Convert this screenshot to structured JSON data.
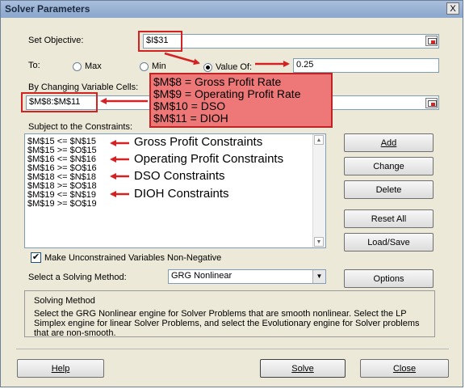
{
  "window": {
    "title": "Solver Parameters",
    "close_glyph": "X"
  },
  "objective": {
    "label": "Set Objective:",
    "value": "$I$31"
  },
  "to": {
    "label": "To:",
    "options": [
      {
        "label": "Max",
        "selected": false
      },
      {
        "label": "Min",
        "selected": false
      },
      {
        "label": "Value Of:",
        "selected": true
      }
    ],
    "value_of": "0.25"
  },
  "variables": {
    "label": "By Changing Variable Cells:",
    "value": "$M$8:$M$11"
  },
  "callout": {
    "lines": [
      "$M$8 = Gross Profit Rate",
      "$M$9 = Operating Profit Rate",
      "$M$10 = DSO",
      "$M$11 = DIOH"
    ]
  },
  "constraints": {
    "label": "Subject to the Constraints:",
    "items": [
      "$M$15 <= $N$15",
      "$M$15 >= $O$15",
      "$M$16 <= $N$16",
      "$M$16 >= $O$16",
      "$M$18 <= $N$18",
      "$M$18 >= $O$18",
      "$M$19 <= $N$19",
      "$M$19 >= $O$19"
    ],
    "annotations": [
      "Gross Profit Constraints",
      "Operating Profit Constraints",
      "DSO Constraints",
      "DIOH Constraints"
    ]
  },
  "buttons": {
    "add": "Add",
    "change": "Change",
    "delete": "Delete",
    "reset_all": "Reset All",
    "load_save": "Load/Save",
    "options": "Options",
    "help": "Help",
    "solve": "Solve",
    "close": "Close"
  },
  "unconstrained": {
    "label": "Make Unconstrained Variables Non-Negative",
    "checked": true,
    "check_glyph": "✔"
  },
  "method": {
    "label": "Select a Solving Method:",
    "value": "GRG Nonlinear"
  },
  "solving": {
    "title": "Solving Method",
    "text": "Select the GRG Nonlinear engine for Solver Problems that are smooth nonlinear. Select the LP Simplex engine for linear Solver Problems, and select the Evolutionary engine for Solver problems that are non-smooth."
  },
  "colors": {
    "annotation_red": "#d42222",
    "callout_fill": "#ee7777"
  }
}
